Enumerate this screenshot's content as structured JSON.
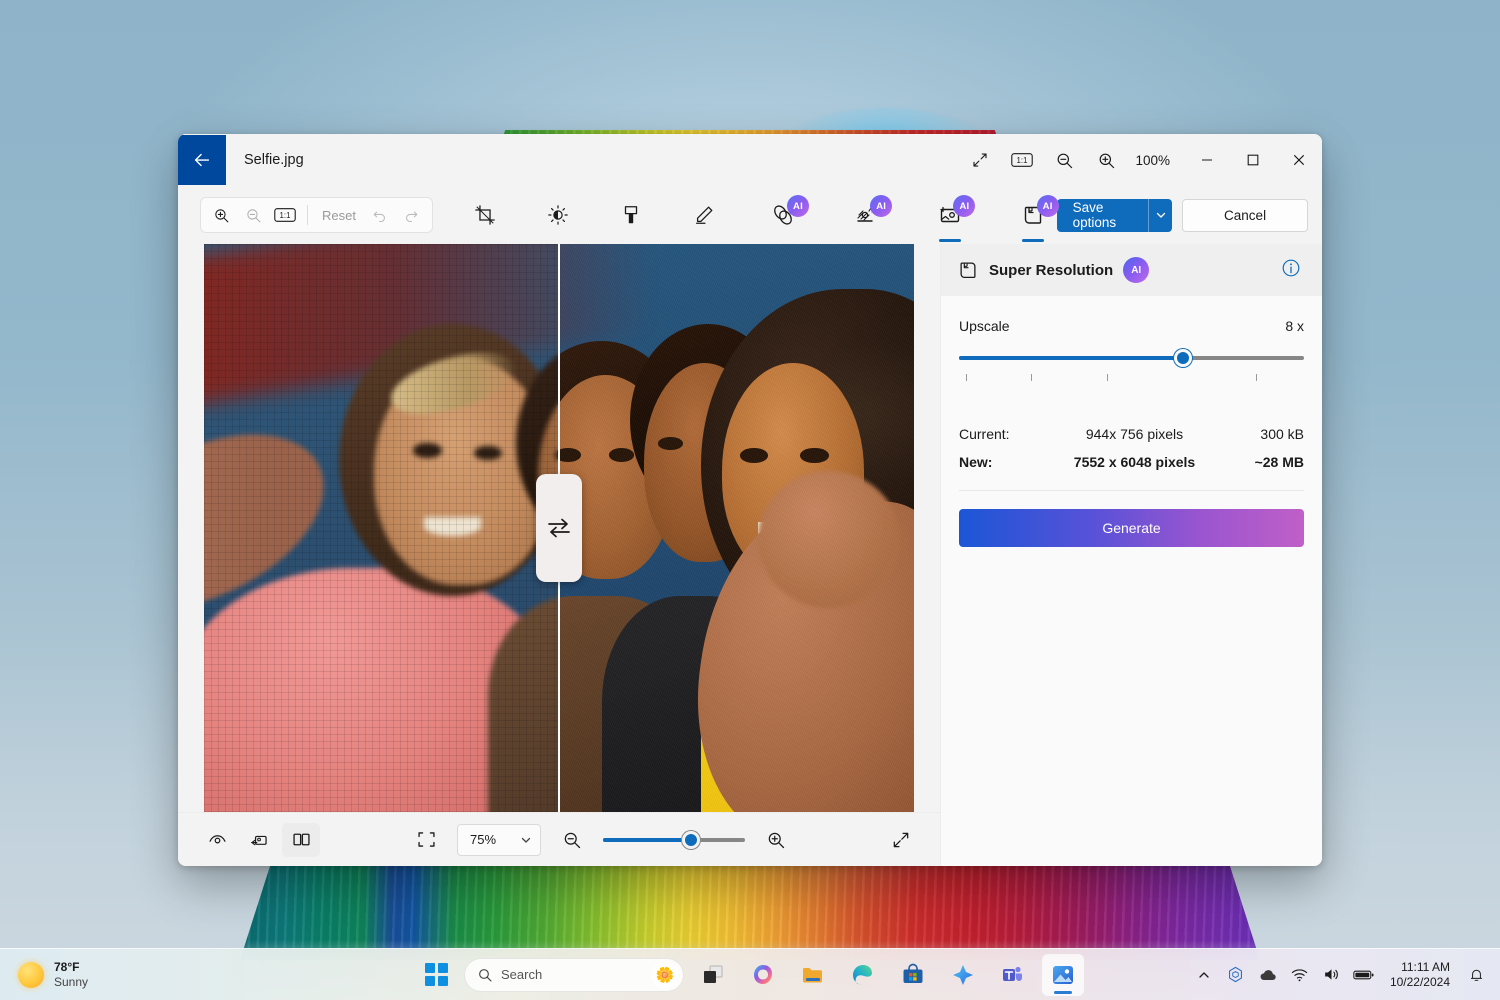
{
  "desktop": {
    "wallpaper_name": "windows-11-bloom-rainbow"
  },
  "window": {
    "title": "Selfie.jpg",
    "back_button": "back-arrow",
    "titlebar_tools": [
      {
        "name": "fit-to-window-icon",
        "label": ""
      },
      {
        "name": "actual-size-icon",
        "label": "1:1"
      },
      {
        "name": "zoom-out-icon",
        "label": ""
      },
      {
        "name": "zoom-in-icon",
        "label": ""
      }
    ],
    "zoom_level": "100%",
    "controls": {
      "minimize": "minimize-icon",
      "maximize": "maximize-icon",
      "close": "close-icon"
    }
  },
  "toolbar": {
    "zoom_group": {
      "zoom_in": "zoom-in-icon",
      "zoom_out": "zoom-out-icon",
      "actual_size": "1:1",
      "reset_label": "Reset",
      "undo": "undo-icon",
      "redo": "redo-icon"
    },
    "tools": [
      {
        "name": "crop-tool",
        "icon": "crop-icon",
        "ai": false,
        "active": false
      },
      {
        "name": "adjustment-tool",
        "icon": "brightness-icon",
        "ai": false,
        "active": false
      },
      {
        "name": "retouch-tool",
        "icon": "eraser-icon",
        "ai": false,
        "active": false
      },
      {
        "name": "markup-tool",
        "icon": "pen-icon",
        "ai": false,
        "active": false
      },
      {
        "name": "blur-background-tool",
        "icon": "blur-icon",
        "ai": true,
        "ai_label": "AI",
        "active": false
      },
      {
        "name": "erase-objects-tool",
        "icon": "magic-eraser-icon",
        "ai": true,
        "ai_label": "AI",
        "active": false
      },
      {
        "name": "generative-erase-tool",
        "icon": "generative-fill-icon",
        "ai": true,
        "ai_label": "AI",
        "active": true
      },
      {
        "name": "super-resolution-tool",
        "icon": "super-resolution-icon",
        "ai": true,
        "ai_label": "AI",
        "active": true
      }
    ],
    "save_label": "Save options",
    "save_chevron": "chevron-down-icon",
    "cancel_label": "Cancel"
  },
  "panel": {
    "title": "Super Resolution",
    "ai_label": "AI",
    "info_icon": "info-icon",
    "upscale": {
      "label": "Upscale",
      "value": "8 x",
      "fill_percent": 65,
      "tick_positions": [
        2,
        21,
        43,
        86
      ]
    },
    "info": {
      "current_label": "Current:",
      "current_dimensions": "944x 756 pixels",
      "current_size": "300 kB",
      "new_label": "New:",
      "new_dimensions": "7552 x 6048 pixels",
      "new_size": "~28 MB"
    },
    "generate_label": "Generate"
  },
  "statusbar": {
    "left_tools": [
      {
        "name": "eye-preview-icon",
        "selected": false
      },
      {
        "name": "compare-original-icon",
        "selected": false
      },
      {
        "name": "split-view-icon",
        "selected": true
      }
    ],
    "fit_icon": "fit-to-screen-icon",
    "zoom_value": "75%",
    "zoom_chevron": "chevron-down-icon",
    "zoom_out_icon": "zoom-out-icon",
    "zoom_in_icon": "zoom-in-icon",
    "zoom_slider_percent": 62,
    "fullscreen_icon": "fullscreen-icon"
  },
  "comparison": {
    "handle_icon": "swap-arrows-icon",
    "divider_percent": 50
  },
  "taskbar": {
    "weather": {
      "temperature": "78°F",
      "condition": "Sunny",
      "icon": "sun-icon"
    },
    "start_label": "start-button",
    "search": {
      "placeholder": "Search",
      "icon": "search-icon",
      "assistant_icon": "lotus-icon"
    },
    "apps": [
      {
        "name": "task-view",
        "icon": "task-view-icon",
        "active": false
      },
      {
        "name": "copilot",
        "icon": "copilot-icon",
        "active": false
      },
      {
        "name": "file-explorer",
        "icon": "folder-icon",
        "active": false
      },
      {
        "name": "microsoft-edge",
        "icon": "edge-icon",
        "active": false
      },
      {
        "name": "microsoft-store",
        "icon": "store-icon",
        "active": false
      },
      {
        "name": "microsoft-designer",
        "icon": "designer-icon",
        "active": false
      },
      {
        "name": "microsoft-teams",
        "icon": "teams-icon",
        "active": false
      },
      {
        "name": "photos",
        "icon": "photos-icon",
        "active": true
      }
    ],
    "tray": [
      {
        "name": "show-hidden-icons",
        "icon": "chevron-up-icon"
      },
      {
        "name": "onedrive-sync",
        "icon": "hexagon-icon"
      },
      {
        "name": "cloud-status",
        "icon": "cloud-icon"
      },
      {
        "name": "network",
        "icon": "wifi-icon"
      },
      {
        "name": "volume",
        "icon": "speaker-icon"
      },
      {
        "name": "battery",
        "icon": "battery-icon"
      }
    ],
    "clock": {
      "time": "11:11 AM",
      "date": "10/22/2024"
    },
    "notifications_icon": "bell-icon"
  }
}
